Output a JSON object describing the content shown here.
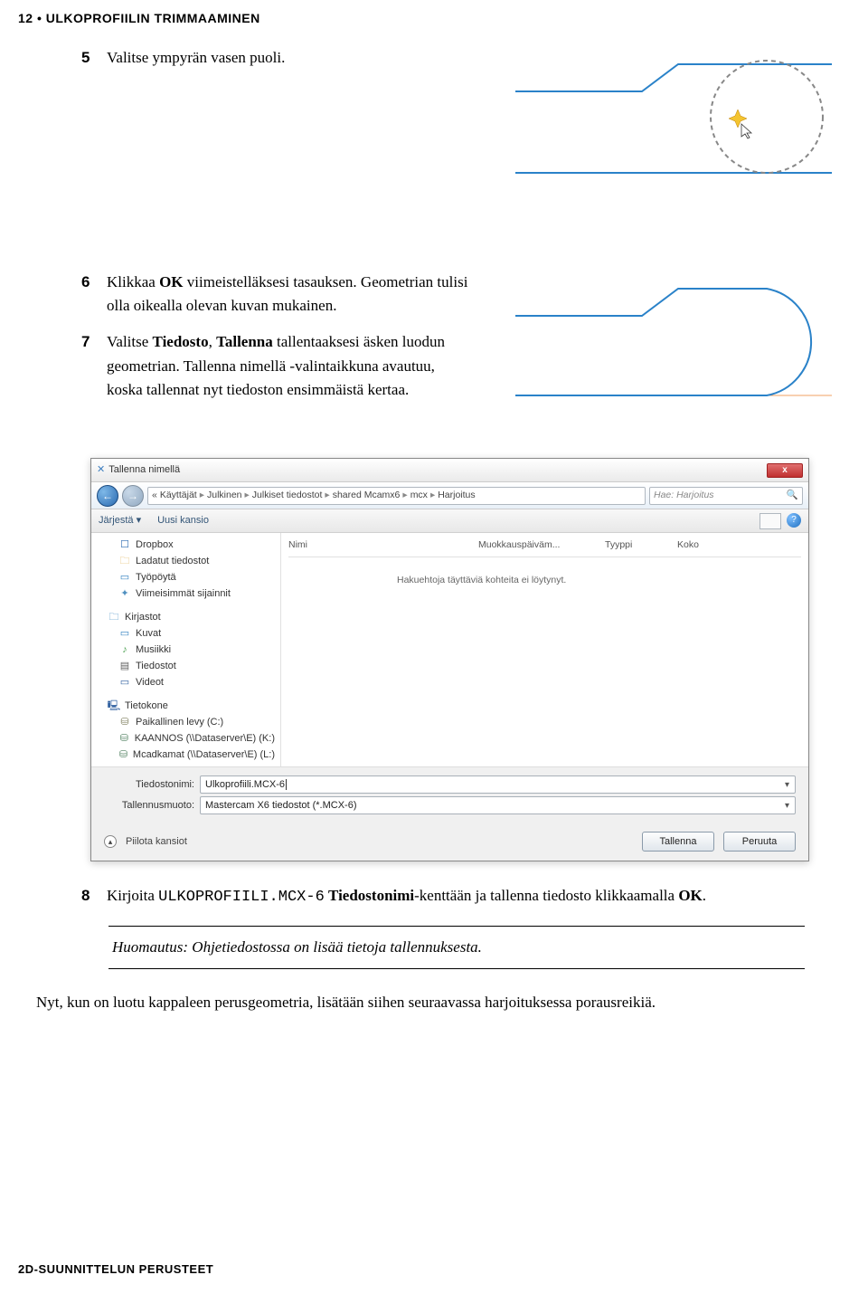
{
  "header": {
    "page_number": "12",
    "section_title": "ULKOPROFIILIN TRIMMAAMINEN"
  },
  "steps": {
    "s5": {
      "num": "5",
      "text": "Valitse ympyrän vasen puoli."
    },
    "s6": {
      "num": "6",
      "lead": "Klikkaa ",
      "b1": "OK",
      "mid": " viimeistelläksesi tasauksen. Geometrian tulisi olla oikealla olevan kuvan mukainen."
    },
    "s7": {
      "num": "7",
      "lead": "Valitse ",
      "b1": "Tiedosto",
      "comma": ", ",
      "b2": "Tallenna",
      "tail": " tallentaaksesi äsken luodun geometrian. Tallenna nimellä -valintaikkuna avautuu, koska tallennat nyt tiedoston ensimmäistä kertaa."
    },
    "s8": {
      "num": "8",
      "lead": "Kirjoita ",
      "code": "ULKOPROFIILI.MCX-6",
      "sp": " ",
      "b1": "Tiedostonimi",
      "mid": "-kenttään ja tallenna tiedosto klikkaamalla ",
      "b2": "OK",
      "dot": "."
    }
  },
  "note": "Huomautus: Ohjetiedostossa on lisää tietoja tallennuksesta.",
  "closing": "Nyt, kun on luotu kappaleen perusgeometria, lisätään siihen seuraavassa harjoituksessa porausreikiä.",
  "footer": "2D-SUUNNITTELUN PERUSTEET",
  "dialog": {
    "title": "Tallenna nimellä",
    "close_x": "x",
    "nav": {
      "back": "←",
      "fwd": "→"
    },
    "path": [
      "«",
      "Käyttäjät",
      "Julkinen",
      "Julkiset tiedostot",
      "shared Mcamx6",
      "mcx",
      "Harjoitus"
    ],
    "path_sep": "▸",
    "refresh": "↻",
    "search_placeholder": "Hae: Harjoitus",
    "search_icon": "🔍",
    "toolbar": {
      "organize": "Järjestä ▾",
      "newfolder": "Uusi kansio",
      "help": "?"
    },
    "tree": [
      {
        "label": "Dropbox",
        "cls": "ic-dropbox",
        "glyph": "☐",
        "nested": true
      },
      {
        "label": "Ladatut tiedostot",
        "cls": "ic-folder",
        "glyph": "🗀",
        "nested": true
      },
      {
        "label": "Työpöytä",
        "cls": "ic-desktop",
        "glyph": "▭",
        "nested": true
      },
      {
        "label": "Viimeisimmät sijainnit",
        "cls": "ic-recent",
        "glyph": "✦",
        "nested": true
      },
      {
        "label": "",
        "cls": "",
        "glyph": "",
        "sep": true
      },
      {
        "label": "Kirjastot",
        "cls": "ic-lib",
        "glyph": "🗀",
        "nested": false
      },
      {
        "label": "Kuvat",
        "cls": "ic-lib",
        "glyph": "▭",
        "nested": true
      },
      {
        "label": "Musiikki",
        "cls": "ic-music",
        "glyph": "♪",
        "nested": true
      },
      {
        "label": "Tiedostot",
        "cls": "ic-doc",
        "glyph": "▤",
        "nested": true
      },
      {
        "label": "Videot",
        "cls": "ic-video",
        "glyph": "▭",
        "nested": true
      },
      {
        "label": "",
        "cls": "",
        "glyph": "",
        "sep": true
      },
      {
        "label": "Tietokone",
        "cls": "ic-computer",
        "glyph": "🖳",
        "nested": false
      },
      {
        "label": "Paikallinen levy (C:)",
        "cls": "ic-drive",
        "glyph": "⛁",
        "nested": true
      },
      {
        "label": "KAANNOS (\\\\Dataserver\\E) (K:)",
        "cls": "ic-netdrive",
        "glyph": "⛁",
        "nested": true
      },
      {
        "label": "Mcadkamat (\\\\Dataserver\\E) (L:)",
        "cls": "ic-netdrive",
        "glyph": "⛁",
        "nested": true
      }
    ],
    "list": {
      "col_name": "Nimi",
      "col_date": "Muokkauspäiväm...",
      "col_type": "Tyyppi",
      "col_size": "Koko",
      "empty": "Hakuehtoja täyttäviä kohteita ei löytynyt."
    },
    "fields": {
      "filename_label": "Tiedostonimi:",
      "filename_value": "Ulkoprofiili.MCX-6",
      "savetype_label": "Tallennusmuoto:",
      "savetype_value": "Mastercam X6 tiedostot (*.MCX-6)"
    },
    "footer": {
      "hide_folders": "Piilota kansiot",
      "save": "Tallenna",
      "cancel": "Peruuta"
    }
  }
}
